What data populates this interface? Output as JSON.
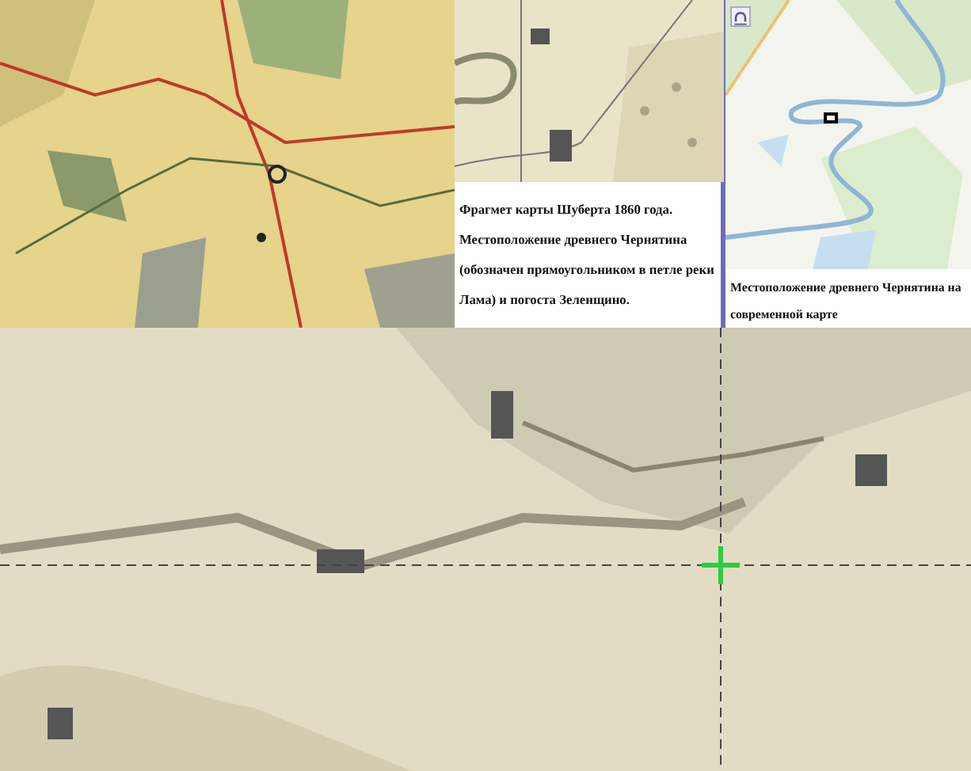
{
  "panels": [
    {
      "kind": "picture"
    },
    {
      "kind": "picture",
      "caption": "Фрагмет карты Шуберта 1860 года. Местоположение древнего Чернятина (обозначен прямоугольником в петле реки Лама) и погоста Зеленщино."
    },
    {
      "kind": "picture",
      "caption": "Местоположение древнего Чернятина на современной карте",
      "map_button": true
    },
    {
      "kind": "picture"
    }
  ]
}
